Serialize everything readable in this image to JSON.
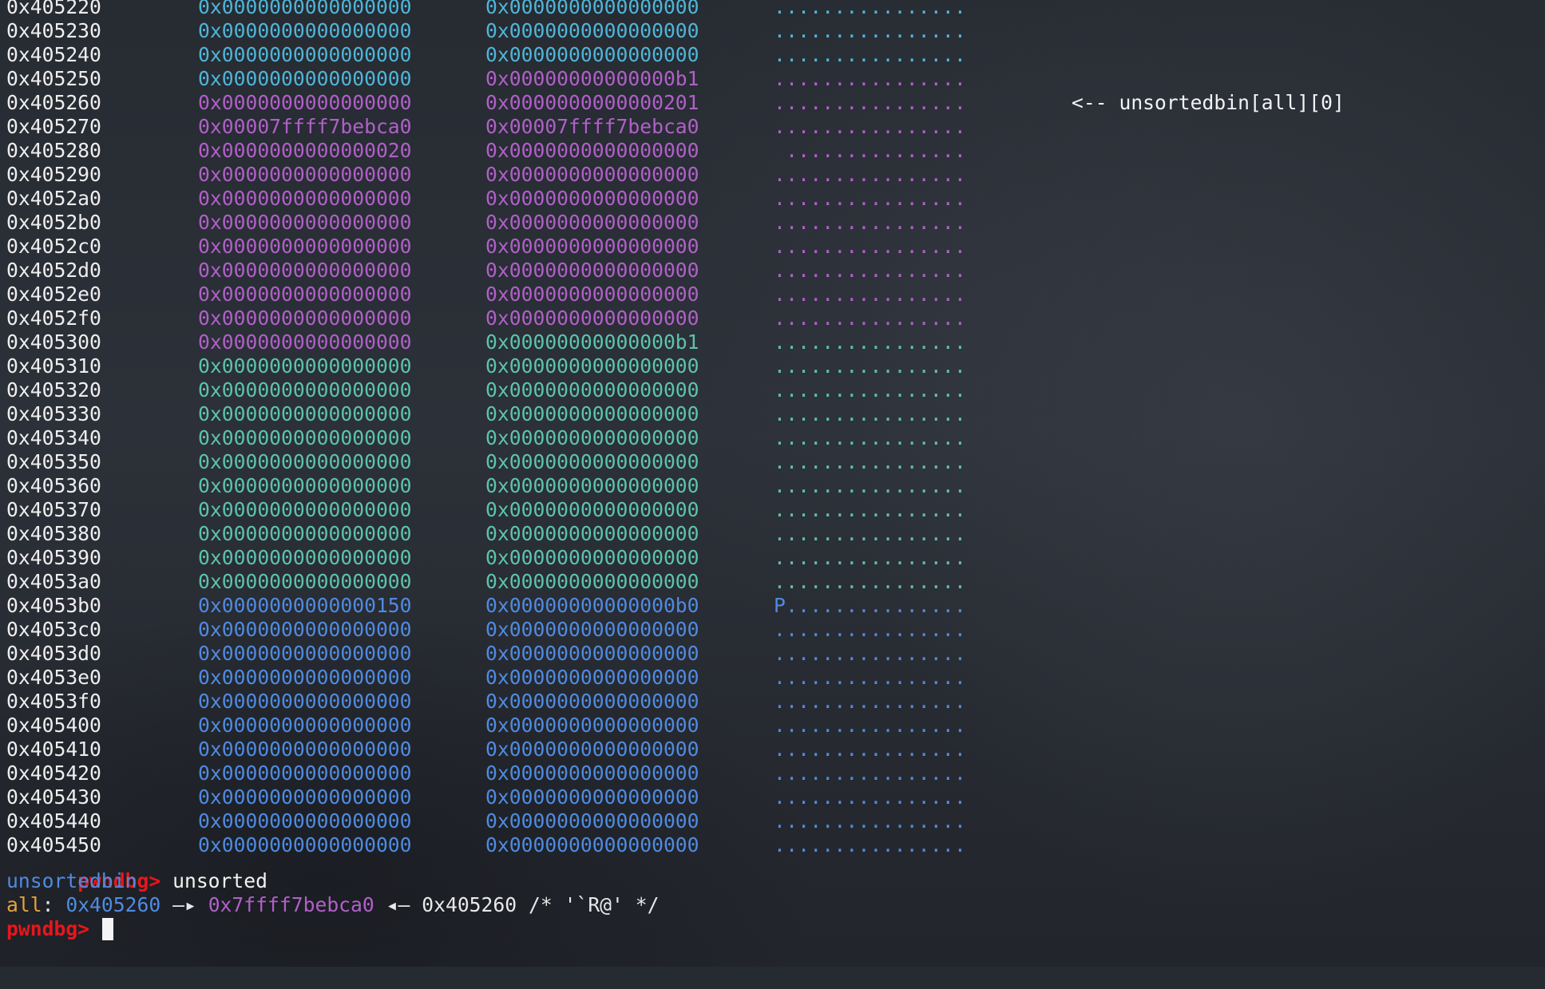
{
  "colors": {
    "background": "#262a31",
    "address": "#eeeeee",
    "prompt": "#e8161b",
    "cyan": "#4fb5d8",
    "purple": "#b060c8",
    "teal": "#5cc3ae",
    "blue": "#4f8be0",
    "orange": "#e5a33a"
  },
  "rows": [
    {
      "addr": "0x405220",
      "q1": "0x0000000000000000",
      "q2": "0x0000000000000000",
      "ascii": "................",
      "c1": "#4fb5d8",
      "c2": "#4fb5d8",
      "ca": "#4fb5d8",
      "note": ""
    },
    {
      "addr": "0x405230",
      "q1": "0x0000000000000000",
      "q2": "0x0000000000000000",
      "ascii": "................",
      "c1": "#4fb5d8",
      "c2": "#4fb5d8",
      "ca": "#4fb5d8",
      "note": ""
    },
    {
      "addr": "0x405240",
      "q1": "0x0000000000000000",
      "q2": "0x0000000000000000",
      "ascii": "................",
      "c1": "#4fb5d8",
      "c2": "#4fb5d8",
      "ca": "#4fb5d8",
      "note": ""
    },
    {
      "addr": "0x405250",
      "q1": "0x0000000000000000",
      "q2": "0x00000000000000b1",
      "ascii": "................",
      "c1": "#4fb5d8",
      "c2": "#b060c8",
      "ca": "#b060c8",
      "note": ""
    },
    {
      "addr": "0x405260",
      "q1": "0x0000000000000000",
      "q2": "0x0000000000000201",
      "ascii": "................",
      "c1": "#b060c8",
      "c2": "#b060c8",
      "ca": "#b060c8",
      "note": "<-- unsortedbin[all][0]"
    },
    {
      "addr": "0x405270",
      "q1": "0x00007ffff7bebca0",
      "q2": "0x00007ffff7bebca0",
      "ascii": "................",
      "c1": "#b060c8",
      "c2": "#b060c8",
      "ca": "#b060c8",
      "note": ""
    },
    {
      "addr": "0x405280",
      "q1": "0x0000000000000020",
      "q2": "0x0000000000000000",
      "ascii": " ...............",
      "c1": "#b060c8",
      "c2": "#b060c8",
      "ca": "#b060c8",
      "note": ""
    },
    {
      "addr": "0x405290",
      "q1": "0x0000000000000000",
      "q2": "0x0000000000000000",
      "ascii": "................",
      "c1": "#b060c8",
      "c2": "#b060c8",
      "ca": "#b060c8",
      "note": ""
    },
    {
      "addr": "0x4052a0",
      "q1": "0x0000000000000000",
      "q2": "0x0000000000000000",
      "ascii": "................",
      "c1": "#b060c8",
      "c2": "#b060c8",
      "ca": "#b060c8",
      "note": ""
    },
    {
      "addr": "0x4052b0",
      "q1": "0x0000000000000000",
      "q2": "0x0000000000000000",
      "ascii": "................",
      "c1": "#b060c8",
      "c2": "#b060c8",
      "ca": "#b060c8",
      "note": ""
    },
    {
      "addr": "0x4052c0",
      "q1": "0x0000000000000000",
      "q2": "0x0000000000000000",
      "ascii": "................",
      "c1": "#b060c8",
      "c2": "#b060c8",
      "ca": "#b060c8",
      "note": ""
    },
    {
      "addr": "0x4052d0",
      "q1": "0x0000000000000000",
      "q2": "0x0000000000000000",
      "ascii": "................",
      "c1": "#b060c8",
      "c2": "#b060c8",
      "ca": "#b060c8",
      "note": ""
    },
    {
      "addr": "0x4052e0",
      "q1": "0x0000000000000000",
      "q2": "0x0000000000000000",
      "ascii": "................",
      "c1": "#b060c8",
      "c2": "#b060c8",
      "ca": "#b060c8",
      "note": ""
    },
    {
      "addr": "0x4052f0",
      "q1": "0x0000000000000000",
      "q2": "0x0000000000000000",
      "ascii": "................",
      "c1": "#b060c8",
      "c2": "#b060c8",
      "ca": "#b060c8",
      "note": ""
    },
    {
      "addr": "0x405300",
      "q1": "0x0000000000000000",
      "q2": "0x00000000000000b1",
      "ascii": "................",
      "c1": "#b060c8",
      "c2": "#5cc3ae",
      "ca": "#5cc3ae",
      "note": ""
    },
    {
      "addr": "0x405310",
      "q1": "0x0000000000000000",
      "q2": "0x0000000000000000",
      "ascii": "................",
      "c1": "#5cc3ae",
      "c2": "#5cc3ae",
      "ca": "#5cc3ae",
      "note": ""
    },
    {
      "addr": "0x405320",
      "q1": "0x0000000000000000",
      "q2": "0x0000000000000000",
      "ascii": "................",
      "c1": "#5cc3ae",
      "c2": "#5cc3ae",
      "ca": "#5cc3ae",
      "note": ""
    },
    {
      "addr": "0x405330",
      "q1": "0x0000000000000000",
      "q2": "0x0000000000000000",
      "ascii": "................",
      "c1": "#5cc3ae",
      "c2": "#5cc3ae",
      "ca": "#5cc3ae",
      "note": ""
    },
    {
      "addr": "0x405340",
      "q1": "0x0000000000000000",
      "q2": "0x0000000000000000",
      "ascii": "................",
      "c1": "#5cc3ae",
      "c2": "#5cc3ae",
      "ca": "#5cc3ae",
      "note": ""
    },
    {
      "addr": "0x405350",
      "q1": "0x0000000000000000",
      "q2": "0x0000000000000000",
      "ascii": "................",
      "c1": "#5cc3ae",
      "c2": "#5cc3ae",
      "ca": "#5cc3ae",
      "note": ""
    },
    {
      "addr": "0x405360",
      "q1": "0x0000000000000000",
      "q2": "0x0000000000000000",
      "ascii": "................",
      "c1": "#5cc3ae",
      "c2": "#5cc3ae",
      "ca": "#5cc3ae",
      "note": ""
    },
    {
      "addr": "0x405370",
      "q1": "0x0000000000000000",
      "q2": "0x0000000000000000",
      "ascii": "................",
      "c1": "#5cc3ae",
      "c2": "#5cc3ae",
      "ca": "#5cc3ae",
      "note": ""
    },
    {
      "addr": "0x405380",
      "q1": "0x0000000000000000",
      "q2": "0x0000000000000000",
      "ascii": "................",
      "c1": "#5cc3ae",
      "c2": "#5cc3ae",
      "ca": "#5cc3ae",
      "note": ""
    },
    {
      "addr": "0x405390",
      "q1": "0x0000000000000000",
      "q2": "0x0000000000000000",
      "ascii": "................",
      "c1": "#5cc3ae",
      "c2": "#5cc3ae",
      "ca": "#5cc3ae",
      "note": ""
    },
    {
      "addr": "0x4053a0",
      "q1": "0x0000000000000000",
      "q2": "0x0000000000000000",
      "ascii": "................",
      "c1": "#5cc3ae",
      "c2": "#5cc3ae",
      "ca": "#5cc3ae",
      "note": ""
    },
    {
      "addr": "0x4053b0",
      "q1": "0x0000000000000150",
      "q2": "0x00000000000000b0",
      "ascii": "P...............",
      "c1": "#4f8be0",
      "c2": "#4f8be0",
      "ca": "#4f8be0",
      "note": ""
    },
    {
      "addr": "0x4053c0",
      "q1": "0x0000000000000000",
      "q2": "0x0000000000000000",
      "ascii": "................",
      "c1": "#4f8be0",
      "c2": "#4f8be0",
      "ca": "#4f8be0",
      "note": ""
    },
    {
      "addr": "0x4053d0",
      "q1": "0x0000000000000000",
      "q2": "0x0000000000000000",
      "ascii": "................",
      "c1": "#4f8be0",
      "c2": "#4f8be0",
      "ca": "#4f8be0",
      "note": ""
    },
    {
      "addr": "0x4053e0",
      "q1": "0x0000000000000000",
      "q2": "0x0000000000000000",
      "ascii": "................",
      "c1": "#4f8be0",
      "c2": "#4f8be0",
      "ca": "#4f8be0",
      "note": ""
    },
    {
      "addr": "0x4053f0",
      "q1": "0x0000000000000000",
      "q2": "0x0000000000000000",
      "ascii": "................",
      "c1": "#4f8be0",
      "c2": "#4f8be0",
      "ca": "#4f8be0",
      "note": ""
    },
    {
      "addr": "0x405400",
      "q1": "0x0000000000000000",
      "q2": "0x0000000000000000",
      "ascii": "................",
      "c1": "#4f8be0",
      "c2": "#4f8be0",
      "ca": "#4f8be0",
      "note": ""
    },
    {
      "addr": "0x405410",
      "q1": "0x0000000000000000",
      "q2": "0x0000000000000000",
      "ascii": "................",
      "c1": "#4f8be0",
      "c2": "#4f8be0",
      "ca": "#4f8be0",
      "note": ""
    },
    {
      "addr": "0x405420",
      "q1": "0x0000000000000000",
      "q2": "0x0000000000000000",
      "ascii": "................",
      "c1": "#4f8be0",
      "c2": "#4f8be0",
      "ca": "#4f8be0",
      "note": ""
    },
    {
      "addr": "0x405430",
      "q1": "0x0000000000000000",
      "q2": "0x0000000000000000",
      "ascii": "................",
      "c1": "#4f8be0",
      "c2": "#4f8be0",
      "ca": "#4f8be0",
      "note": ""
    },
    {
      "addr": "0x405440",
      "q1": "0x0000000000000000",
      "q2": "0x0000000000000000",
      "ascii": "................",
      "c1": "#4f8be0",
      "c2": "#4f8be0",
      "ca": "#4f8be0",
      "note": ""
    },
    {
      "addr": "0x405450",
      "q1": "0x0000000000000000",
      "q2": "0x0000000000000000",
      "ascii": "................",
      "c1": "#4f8be0",
      "c2": "#4f8be0",
      "ca": "#4f8be0",
      "note": ""
    }
  ],
  "command": {
    "prompt": "pwndbg> ",
    "text": "unsorted"
  },
  "bin_title": "unsortedbin",
  "bin_line": {
    "label": "all",
    "colon": ": ",
    "ptr1": "0x405260",
    "arrow1": " —▸ ",
    "ptr2": "0x7ffff7bebca0",
    "arrow2": " ◂— ",
    "rest": "0x405260 /* '`R@' */"
  },
  "input_prompt": "pwndbg> "
}
